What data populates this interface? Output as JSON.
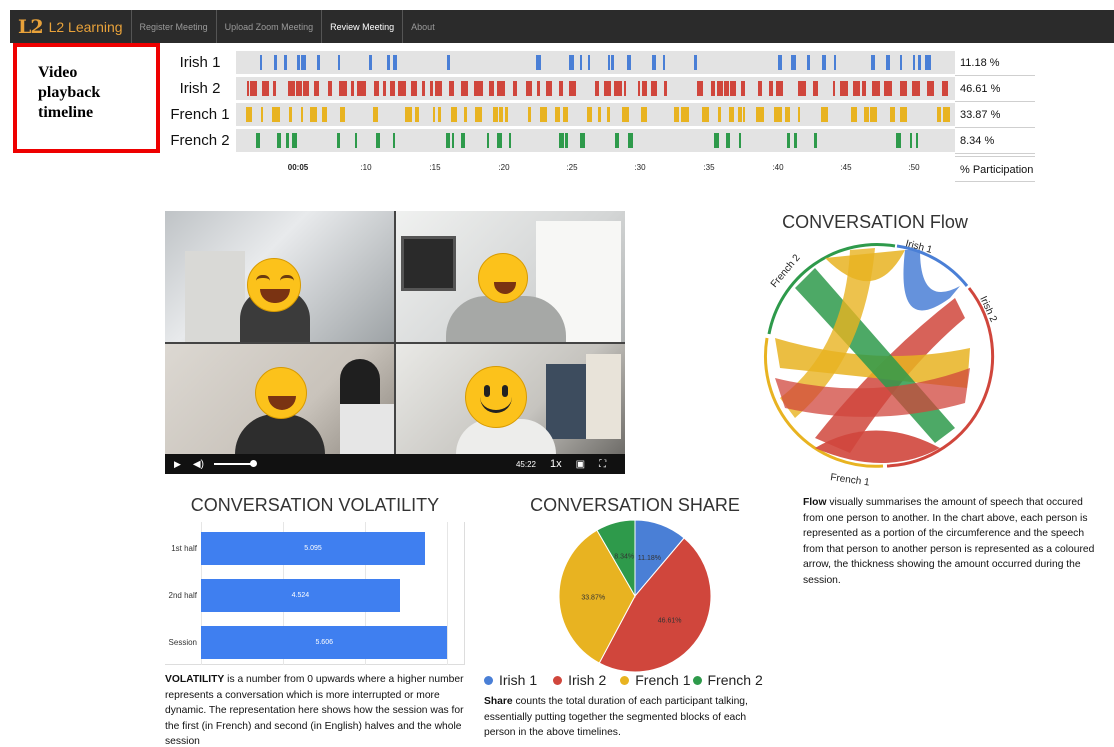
{
  "nav": {
    "logo": "L2",
    "brand": "L2 Learning",
    "links": [
      "Register Meeting",
      "Upload Zoom Meeting",
      "Review Meeting",
      "About"
    ]
  },
  "annotation": {
    "lines": [
      "Video",
      "playback",
      "timeline"
    ]
  },
  "timeline": {
    "participants": [
      {
        "name": "Irish 1",
        "pct": "11.18 %",
        "color": "#4a7fd6"
      },
      {
        "name": "Irish 2",
        "pct": "46.61 %",
        "color": "#d0463c"
      },
      {
        "name": "French 1",
        "pct": "33.87 %",
        "color": "#e8b321"
      },
      {
        "name": "French 2",
        "pct": "8.34 %",
        "color": "#2e9a4b"
      }
    ],
    "ticks": [
      "00:05",
      ":10",
      ":15",
      ":20",
      ":25",
      ":30",
      ":35",
      ":40",
      ":45",
      ":50"
    ],
    "footer": "% Participation"
  },
  "video": {
    "time": "45:22",
    "speed": "1x"
  },
  "volatility": {
    "title": "CONVERSATION VOLATILITY",
    "rows": [
      {
        "label": "1st half",
        "value": 5.095,
        "text": "5.095"
      },
      {
        "label": "2nd half",
        "value": 4.524,
        "text": "4.524"
      },
      {
        "label": "Session",
        "value": 5.606,
        "text": "5.606"
      }
    ],
    "max": 5.8,
    "caption_bold": "VOLATILITY",
    "caption": " is a number from 0 upwards where a higher number represents a conversation which is more interrupted or more dynamic. The representation here shows how the session was for the first (in French) and second (in English) halves and the whole session"
  },
  "share": {
    "title": "CONVERSATION SHARE",
    "legend": [
      "Irish 1",
      "Irish 2",
      "French 1",
      "French 2"
    ],
    "caption_bold": "Share",
    "caption": " counts the total duration of each participant talking, essentially putting together the segmented blocks of each person in the above timelines."
  },
  "chart_data": {
    "type": "pie",
    "title": "CONVERSATION SHARE",
    "categories": [
      "Irish 1",
      "Irish 2",
      "French 1",
      "French 2"
    ],
    "values": [
      11.18,
      46.61,
      33.87,
      8.34
    ],
    "labels": [
      "11.18%",
      "46.61%",
      "33.87%",
      "8.34%"
    ],
    "colors": [
      "#4a7fd6",
      "#d0463c",
      "#e8b321",
      "#2e9a4b"
    ],
    "legend": "bottom"
  },
  "flow": {
    "title": "CONVERSATION Flow",
    "arc_labels": [
      "Irish 1",
      "Irish 2",
      "French 1",
      "French 2"
    ],
    "caption_bold": "Flow",
    "caption": " visually summarises the amount of speech that occured from one person to another. In the chart above, each person is represented as a portion of the circumference and the speech from that person to another person is represented as a coloured arrow, the thickness showing the amount occurred during the session."
  }
}
